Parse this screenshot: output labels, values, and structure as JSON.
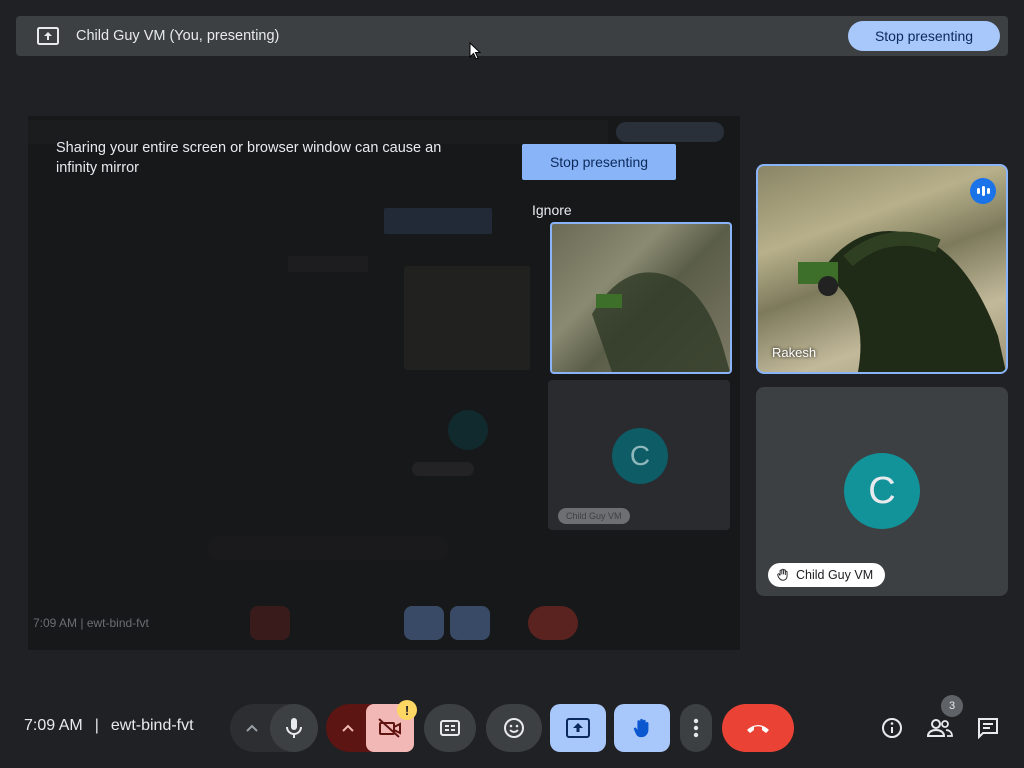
{
  "banner": {
    "title": "Child Guy VM (You, presenting)",
    "stop_label": "Stop presenting"
  },
  "shared_screen": {
    "warning_text": "Sharing your entire screen or browser window can cause an infinity mirror",
    "stop_label": "Stop presenting",
    "ignore_label": "Ignore",
    "inner_avatar_letter": "C",
    "inner_name": "Child Guy VM",
    "inner_time": "7:09 AM  |  ewt-bind-fvt"
  },
  "participants": [
    {
      "name": "Rakesh",
      "speaking": true
    },
    {
      "name": "Child Guy VM",
      "avatar_letter": "C",
      "hand_raised": true
    }
  ],
  "bottom_bar": {
    "time": "7:09 AM",
    "meeting_code": "ewt-bind-fvt",
    "people_count": "3",
    "camera_warning": "!"
  },
  "colors": {
    "background": "#202124",
    "accent": "#a8c7fa",
    "end_call": "#ea4335",
    "avatar": "#12939a"
  }
}
